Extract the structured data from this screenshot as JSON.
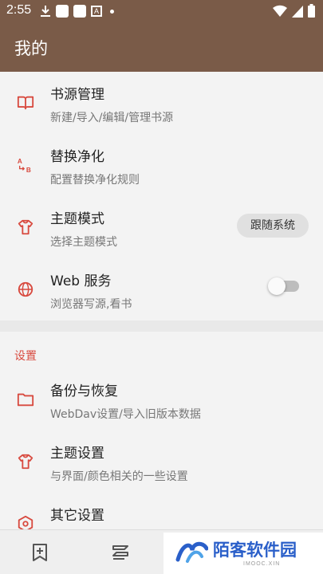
{
  "status_bar": {
    "time": "2:55",
    "a_label": "A"
  },
  "app_bar": {
    "title": "我的"
  },
  "items": [
    {
      "title": "书源管理",
      "subtitle": "新建/导入/编辑/管理书源",
      "icon": "book-open-icon"
    },
    {
      "title": "替换净化",
      "subtitle": "配置替换净化规则",
      "icon": "replace-ab-icon"
    },
    {
      "title": "主题模式",
      "subtitle": "选择主题模式",
      "icon": "shirt-icon",
      "value": "跟随系统"
    },
    {
      "title": "Web 服务",
      "subtitle": "浏览器写源,看书",
      "icon": "globe-icon",
      "toggle": false
    }
  ],
  "settings_section": {
    "header": "设置"
  },
  "settings_items": [
    {
      "title": "备份与恢复",
      "subtitle": "WebDav设置/导入旧版本数据",
      "icon": "folder-icon"
    },
    {
      "title": "主题设置",
      "subtitle": "与界面/颜色相关的一些设置",
      "icon": "shirt-icon"
    },
    {
      "title": "其它设置",
      "subtitle": "",
      "icon": "settings-hexagon-icon"
    }
  ],
  "watermark": {
    "text": "陌客软件园",
    "sub": "IMOOC.XIN"
  },
  "colors": {
    "primary": "#7a5b48",
    "accent": "#d84a3f"
  }
}
